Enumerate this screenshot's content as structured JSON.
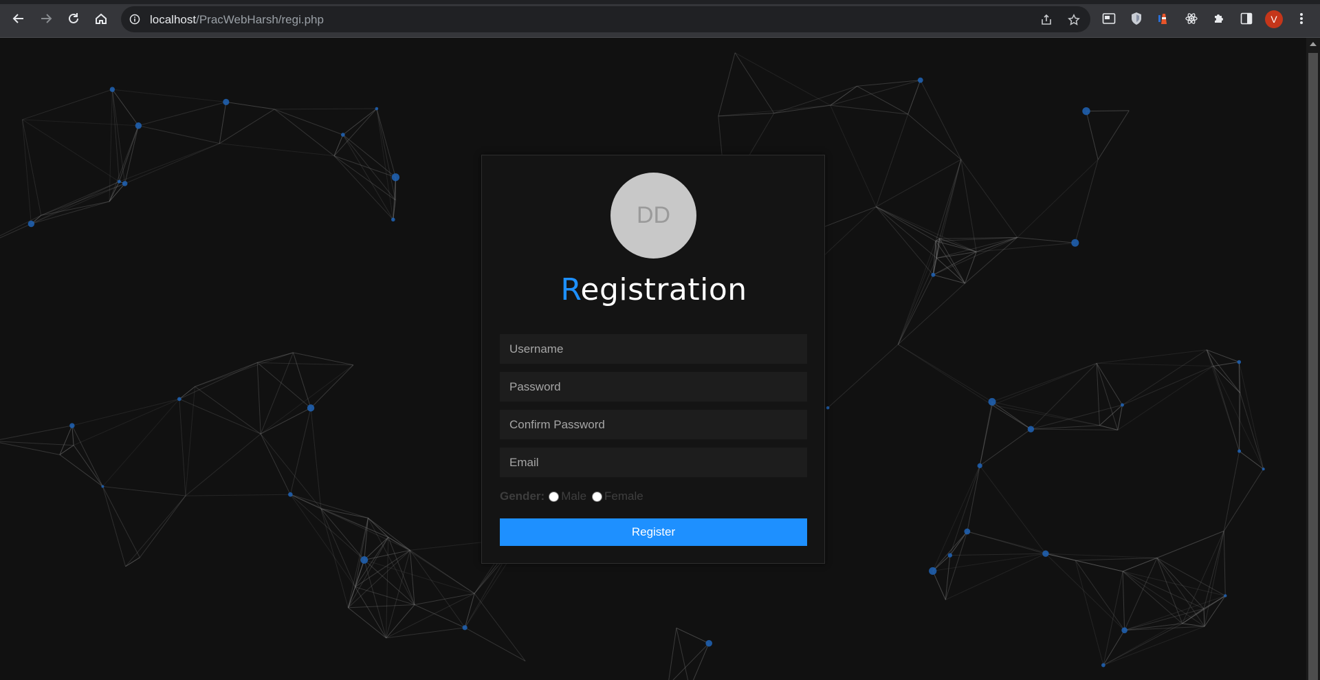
{
  "browser": {
    "url_host": "localhost",
    "url_path": "/PracWebHarsh/regi.php",
    "profile_initial": "V"
  },
  "page": {
    "logo_text": "DD",
    "title_first": "R",
    "title_rest": "egistration",
    "accent_color": "#1e90ff",
    "fields": {
      "username_placeholder": "Username",
      "password_placeholder": "Password",
      "confirm_placeholder": "Confirm Password",
      "email_placeholder": "Email"
    },
    "gender": {
      "label": "Gender:",
      "male": "Male",
      "female": "Female"
    },
    "register_label": "Register"
  }
}
